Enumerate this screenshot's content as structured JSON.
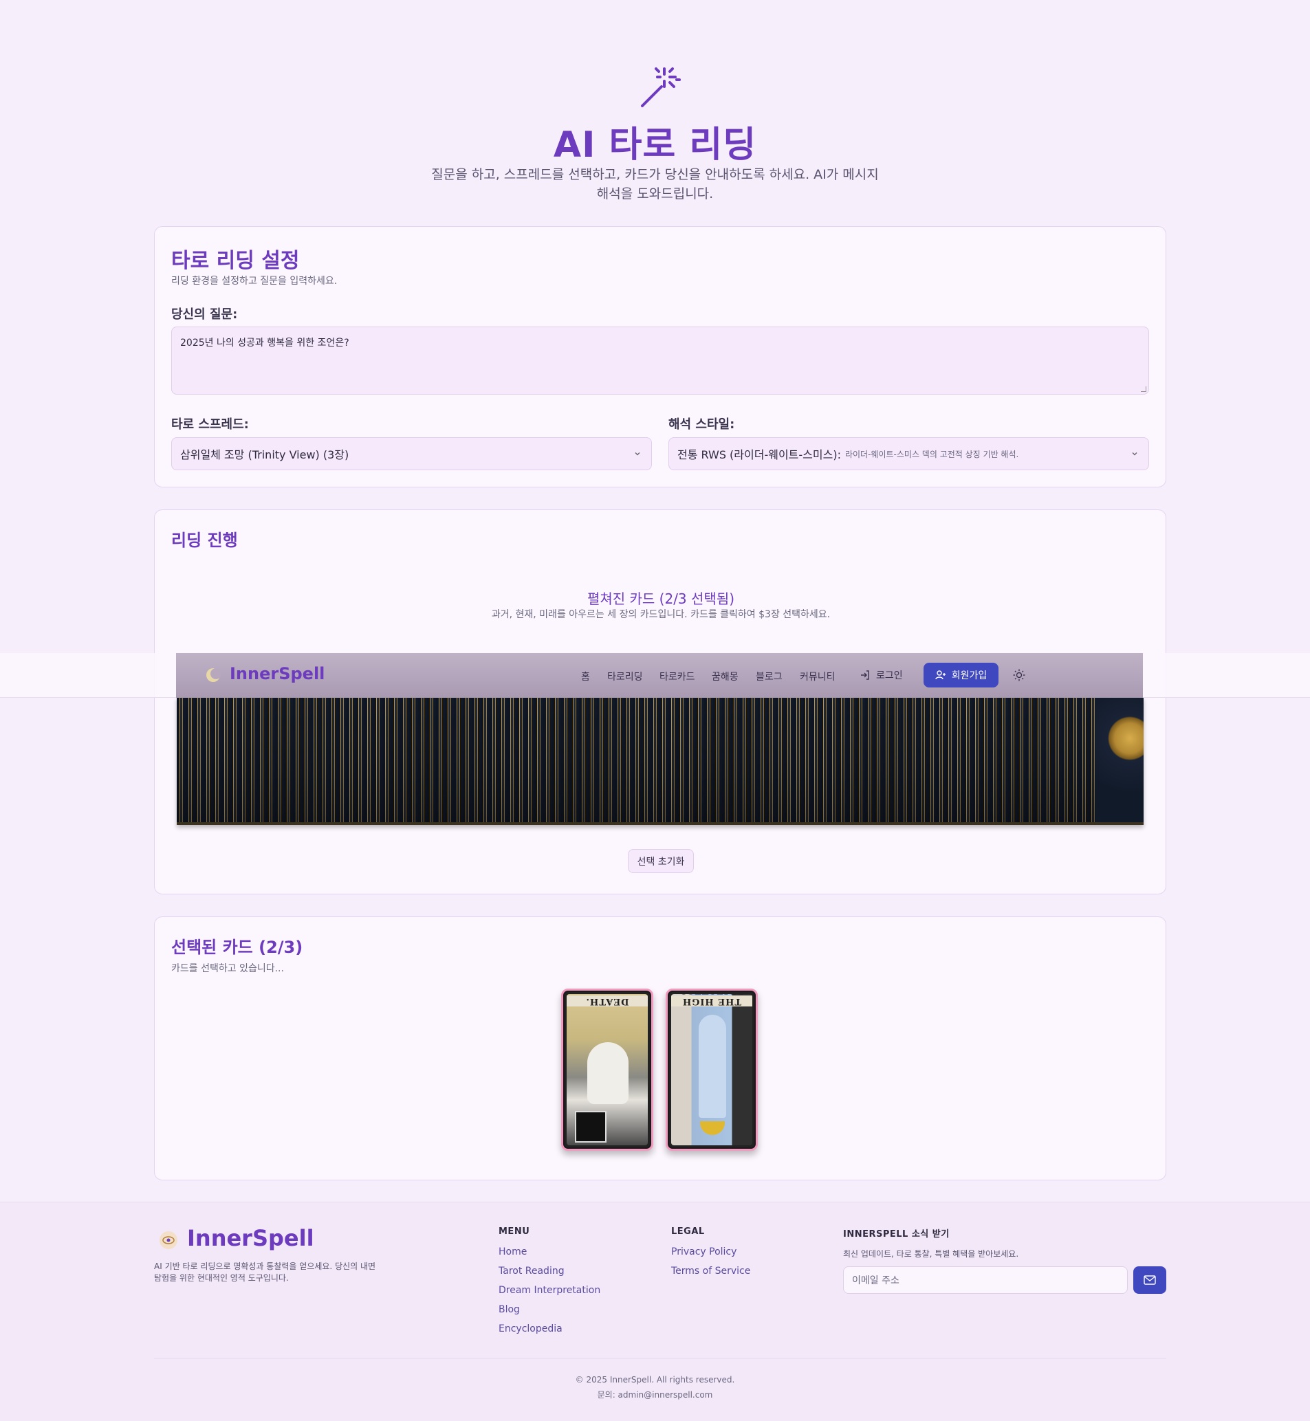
{
  "hero": {
    "title": "AI 타로 리딩",
    "subtitle": "질문을 하고, 스프레드를 선택하고, 카드가 당신을 안내하도록 하세요. AI가 메시지 해석을 도와드립니다.",
    "icon": "magic-wand-icon"
  },
  "settings": {
    "title": "타로 리딩 설정",
    "description": "리딩 환경을 설정하고 질문을 입력하세요.",
    "question_label": "당신의 질문:",
    "question_value": "2025년 나의 성공과 행복을 위한 조언은?",
    "spread_label": "타로 스프레드:",
    "spread_value": "삼위일체 조망 (Trinity View) (3장)",
    "style_label": "해석 스타일:",
    "style_value": "전통 RWS (라이더-웨이트-스미스):",
    "style_hint": "라이더-웨이트-스미스 덱의 고전적 상징 기반 해석."
  },
  "progress": {
    "title": "리딩 진행",
    "deck_title": "펼쳐진 카드 (2/3 선택됨)",
    "deck_subtitle": "과거, 현재, 미래를 아우르는 세 장의 카드입니다. 카드를 클릭하여 $3장 선택하세요.",
    "reset_label": "선택 초기화"
  },
  "navbar": {
    "brand": "InnerSpell",
    "links": [
      "홈",
      "타로리딩",
      "타로카드",
      "꿈해몽",
      "블로그",
      "커뮤니티"
    ],
    "login_label": "로그인",
    "signup_label": "회원가입"
  },
  "selected": {
    "title": "선택된 카드 (2/3)",
    "description": "카드를 선택하고 있습니다...",
    "cards": [
      {
        "name": "DEATH.",
        "orientation": "reversed"
      },
      {
        "name": "THE HIGH PRIESTESS",
        "orientation": "reversed"
      }
    ]
  },
  "footer": {
    "brand": "InnerSpell",
    "description": "AI 기반 타로 리딩으로 명확성과 통찰력을 얻으세요. 당신의 내면 탐험을 위한 현대적인 영적 도구입니다.",
    "menu_title": "MENU",
    "menu_links": [
      "Home",
      "Tarot Reading",
      "Dream Interpretation",
      "Blog",
      "Encyclopedia"
    ],
    "legal_title": "LEGAL",
    "legal_links": [
      "Privacy Policy",
      "Terms of Service"
    ],
    "news_title": "INNERSPELL 소식 받기",
    "news_desc": "최신 업데이트, 타로 통찰, 특별 혜택을 받아보세요.",
    "email_placeholder": "이메일 주소",
    "copyright": "© 2025 InnerSpell. All rights reserved.",
    "contact": "문의: admin@innerspell.com"
  },
  "colors": {
    "accent": "#6d3bbd",
    "button": "#4048c0",
    "background": "#f6eefb",
    "card_border": "#f29ac0"
  }
}
